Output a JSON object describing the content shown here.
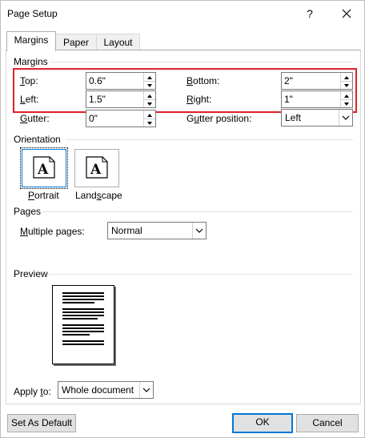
{
  "window": {
    "title": "Page Setup",
    "help_glyph": "?",
    "close_label": "close"
  },
  "tabs": [
    {
      "label": "Margins",
      "active": true
    },
    {
      "label": "Paper",
      "active": false
    },
    {
      "label": "Layout",
      "active": false
    }
  ],
  "margins": {
    "section": "Margins",
    "top": {
      "label": "Top:",
      "value": "0.6\""
    },
    "bottom": {
      "label": "Bottom:",
      "value": "2\""
    },
    "left": {
      "label": "Left:",
      "value": "1.5\""
    },
    "right": {
      "label": "Right:",
      "value": "1\""
    },
    "gutter": {
      "label": "Gutter:",
      "value": "0\""
    },
    "gutter_position": {
      "label": "Gutter position:",
      "value": "Left"
    }
  },
  "orientation": {
    "section": "Orientation",
    "portrait": {
      "label": "Portrait",
      "glyph": "A",
      "selected": true
    },
    "landscape": {
      "label": "Landscape",
      "glyph": "A",
      "selected": false
    }
  },
  "pages": {
    "section": "Pages",
    "multiple_pages": {
      "label": "Multiple pages:",
      "value": "Normal"
    }
  },
  "preview": {
    "section": "Preview"
  },
  "apply_to": {
    "label": "Apply to:",
    "value": "Whole document"
  },
  "buttons": {
    "set_default": "Set As Default",
    "ok": "OK",
    "cancel": "Cancel"
  },
  "colors": {
    "highlight": "#e0202a",
    "accent": "#0078d7"
  }
}
